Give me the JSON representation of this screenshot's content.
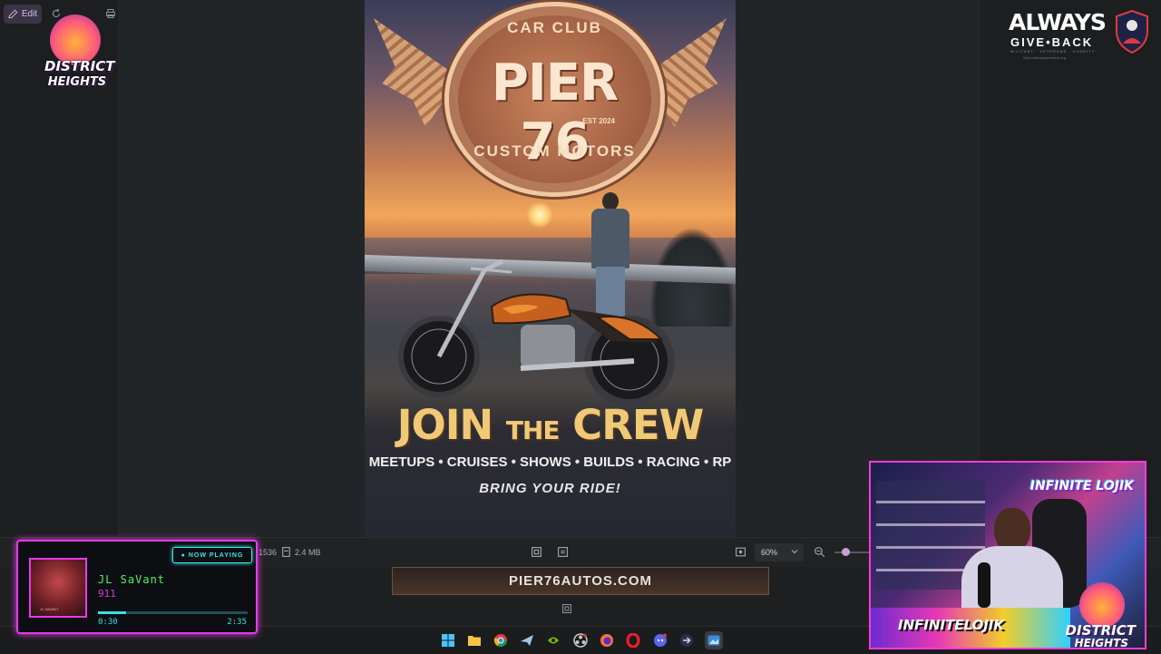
{
  "app": {
    "edit_label": "Edit",
    "file_info": {
      "dims_partial": "1536",
      "size": "2.4 MB"
    },
    "zoom": {
      "value": "60%",
      "level_fraction": 0.6
    }
  },
  "overlays": {
    "district_logo": {
      "line1": "DISTRICT",
      "line2": "HEIGHTS"
    },
    "always_give_back": {
      "line1": "ALWAYS",
      "line2": "GIVE•BACK",
      "line3": "MILITARY · VETERANS · CHARITY",
      "line4": "https://alwaysgiveback.org"
    },
    "now_playing": {
      "badge": "● NOW PLAYING",
      "artist": "JL SaVant",
      "track": "911",
      "elapsed": "0:30",
      "total": "2:35",
      "progress_fraction": 0.19,
      "art_label": "JL SAVANT"
    },
    "webcam": {
      "top_tag": "INFINITE LOJIK",
      "banner": "INFINITELOJIK",
      "district_line1": "DISTRICT",
      "district_line2": "HEIGHTS"
    }
  },
  "poster": {
    "badge_top": "CAR CLUB",
    "badge_main": "PIER 76",
    "badge_est": "EST 2024",
    "badge_bottom": "CUSTOM MOTORS",
    "headline_join": "JOIN",
    "headline_the": "THE",
    "headline_crew": "CREW",
    "tags": "MEETUPS • CRUISES • SHOWS • BUILDS • RACING • RP",
    "tagline": "BRING YOUR RIDE!",
    "url": "PIER76AUTOS.COM"
  },
  "colors": {
    "accent_purple": "#c9a0d8",
    "neon_pink": "#e43ce8",
    "neon_cyan": "#39e0e6",
    "neon_green": "#56f05e",
    "poster_gold": "#f0c977"
  },
  "taskbar": {
    "apps": [
      "windows-start-icon",
      "file-explorer-icon",
      "chrome-icon",
      "steam-icon",
      "nvidia-icon",
      "obs-icon",
      "firefox-icon",
      "opera-icon",
      "discord-icon",
      "arrow-app-icon",
      "photos-app-icon"
    ]
  }
}
